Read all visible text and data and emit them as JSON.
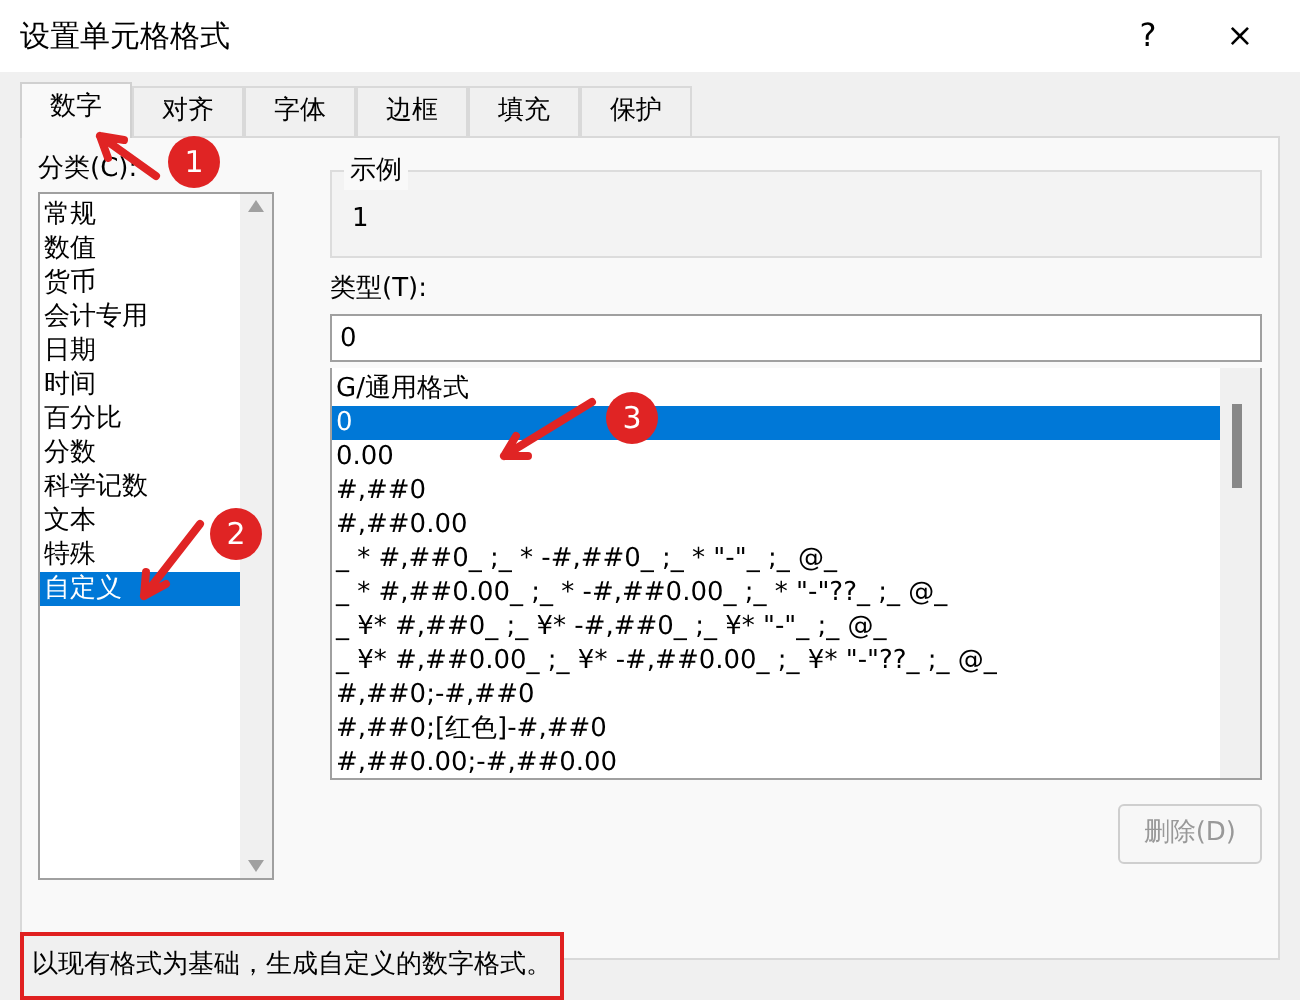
{
  "window": {
    "title": "设置单元格格式",
    "help": "?",
    "close": "×"
  },
  "tabs": [
    {
      "label": "数字",
      "selected": true
    },
    {
      "label": "对齐",
      "selected": false
    },
    {
      "label": "字体",
      "selected": false
    },
    {
      "label": "边框",
      "selected": false
    },
    {
      "label": "填充",
      "selected": false
    },
    {
      "label": "保护",
      "selected": false
    }
  ],
  "category": {
    "label": "分类(C):",
    "items": [
      {
        "label": "常规",
        "selected": false
      },
      {
        "label": "数值",
        "selected": false
      },
      {
        "label": "货币",
        "selected": false
      },
      {
        "label": "会计专用",
        "selected": false
      },
      {
        "label": "日期",
        "selected": false
      },
      {
        "label": "时间",
        "selected": false
      },
      {
        "label": "百分比",
        "selected": false
      },
      {
        "label": "分数",
        "selected": false
      },
      {
        "label": "科学记数",
        "selected": false
      },
      {
        "label": "文本",
        "selected": false
      },
      {
        "label": "特殊",
        "selected": false
      },
      {
        "label": "自定义",
        "selected": true
      }
    ]
  },
  "sample": {
    "label": "示例",
    "value": "1"
  },
  "type": {
    "label": "类型(T):",
    "value": "0",
    "items": [
      {
        "label": "G/通用格式",
        "selected": false
      },
      {
        "label": "0",
        "selected": true
      },
      {
        "label": "0.00",
        "selected": false
      },
      {
        "label": "#,##0",
        "selected": false
      },
      {
        "label": "#,##0.00",
        "selected": false
      },
      {
        "label": "_ * #,##0_ ;_ * -#,##0_ ;_ * \"-\"_ ;_ @_",
        "selected": false
      },
      {
        "label": "_ * #,##0.00_ ;_ * -#,##0.00_ ;_ * \"-\"??_ ;_ @_",
        "selected": false
      },
      {
        "label": "_ ¥* #,##0_ ;_ ¥* -#,##0_ ;_ ¥* \"-\"_ ;_ @_",
        "selected": false
      },
      {
        "label": "_ ¥* #,##0.00_ ;_ ¥* -#,##0.00_ ;_ ¥* \"-\"??_ ;_ @_",
        "selected": false
      },
      {
        "label": "#,##0;-#,##0",
        "selected": false
      },
      {
        "label": "#,##0;[红色]-#,##0",
        "selected": false
      },
      {
        "label": "#,##0.00;-#,##0.00",
        "selected": false
      }
    ]
  },
  "delete_button": {
    "label": "删除(D)",
    "disabled": true
  },
  "hint": "以现有格式为基础，生成自定义的数字格式。",
  "annotations": [
    {
      "number": "1"
    },
    {
      "number": "2"
    },
    {
      "number": "3"
    }
  ]
}
